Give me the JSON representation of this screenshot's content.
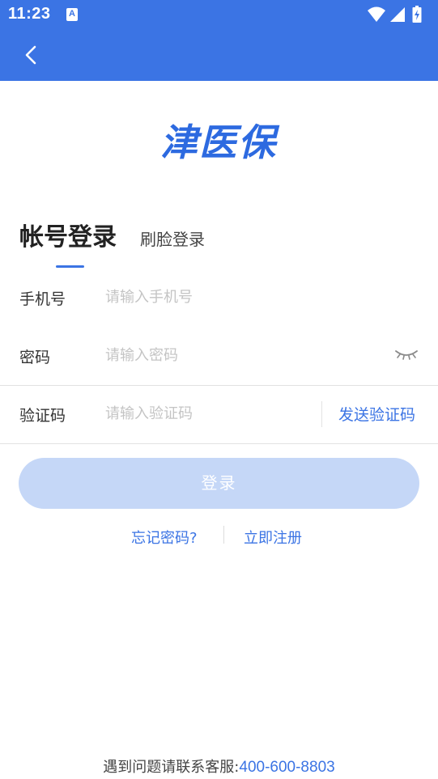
{
  "status_bar": {
    "time": "11:23",
    "app_icon_letter": "A",
    "icons": [
      "wifi-icon",
      "signal-icon",
      "battery-charging-icon"
    ]
  },
  "header": {
    "back_icon": "chevron-left-icon",
    "color": "#3b74e4"
  },
  "logo": {
    "text": "津医保",
    "color": "#2d6ae0"
  },
  "tabs": [
    {
      "label": "帐号登录",
      "active": true
    },
    {
      "label": "刷脸登录",
      "active": false
    }
  ],
  "form": {
    "phone": {
      "label": "手机号",
      "placeholder": "请输入手机号",
      "value": ""
    },
    "password": {
      "label": "密码",
      "placeholder": "请输入密码",
      "value": "",
      "toggle_icon": "eye-closed-icon"
    },
    "code": {
      "label": "验证码",
      "placeholder": "请输入验证码",
      "value": "",
      "send_label": "发送验证码"
    }
  },
  "login_button": {
    "label": "登录",
    "enabled": false
  },
  "links": {
    "forgot": "忘记密码?",
    "register": "立即注册"
  },
  "support": {
    "label": "遇到问题请联系客服:",
    "phone": "400-600-8803"
  }
}
